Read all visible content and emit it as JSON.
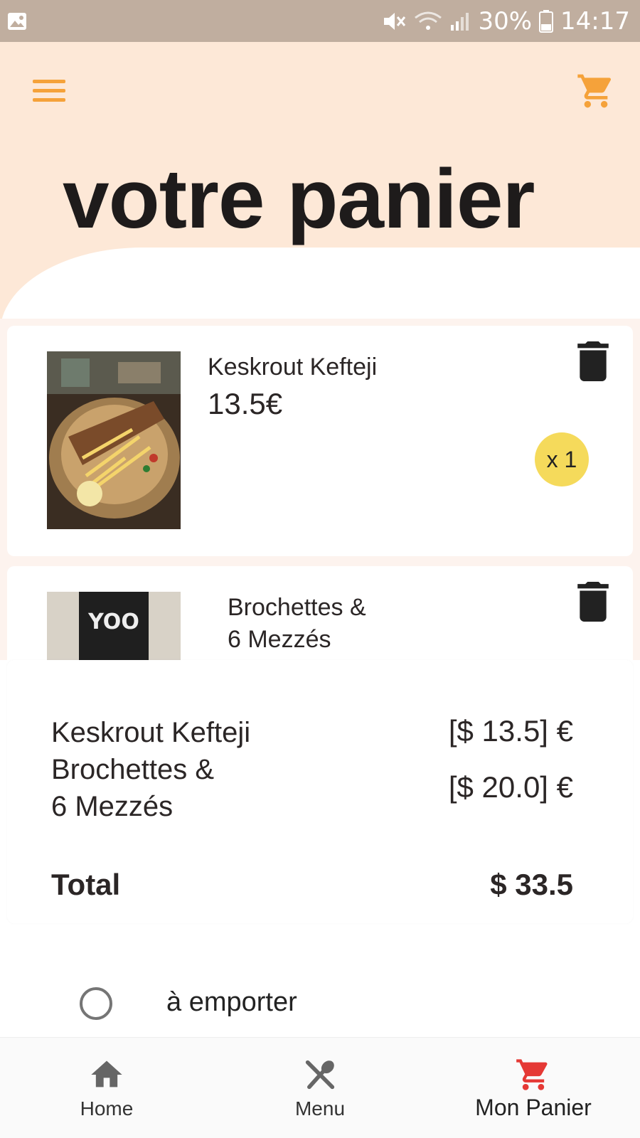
{
  "status_bar": {
    "battery": "30%",
    "time": "14:17"
  },
  "page": {
    "title": "votre panier"
  },
  "cart_items": [
    {
      "name": "Keskrout Kefteji",
      "price": "13.5€",
      "quantity": "x 1"
    },
    {
      "name": "Brochettes &\n 6 Mezzés"
    }
  ],
  "summary": {
    "names": "Keskrout Kefteji\nBrochettes &\n 6 Mezzés",
    "prices": [
      "[$ 13.5] €",
      "[$ 20.0] €"
    ],
    "total_label": "Total",
    "total_value": "$ 33.5"
  },
  "order_option": {
    "label": "à emporter"
  },
  "bottom_nav": {
    "home": "Home",
    "menu": "Menu",
    "cart": "Mon Panier"
  },
  "colors": {
    "accent_orange": "#f5a23a",
    "header_bg": "#fde8d7",
    "badge_yellow": "#f5da5b",
    "active_red": "#e53935"
  },
  "icons": [
    "gallery-icon",
    "mute-icon",
    "wifi-icon",
    "signal-icon",
    "battery-icon",
    "menu-icon",
    "cart-icon",
    "trash-icon",
    "home-icon",
    "utensils-icon"
  ]
}
